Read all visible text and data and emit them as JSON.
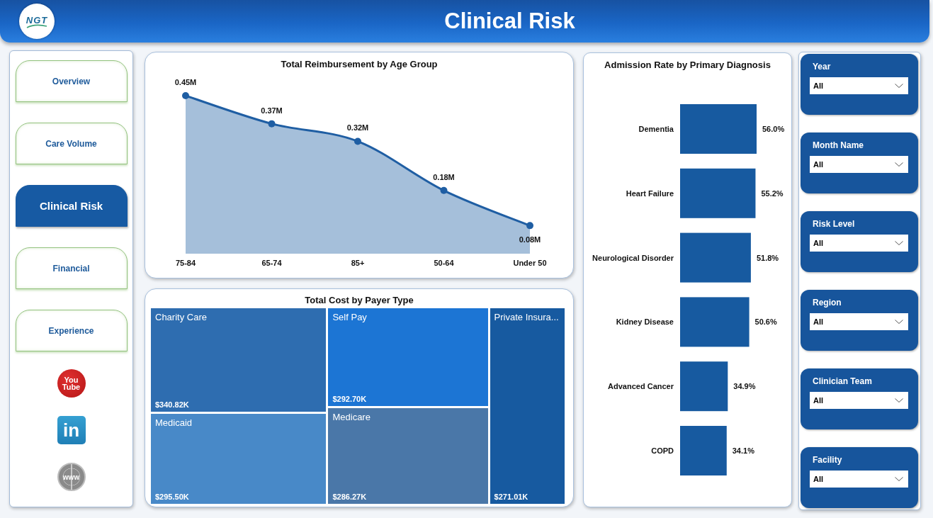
{
  "header": {
    "logo_text": "NGT",
    "title": "Clinical Risk"
  },
  "nav": {
    "items": [
      {
        "label": "Overview",
        "selected": false
      },
      {
        "label": "Care Volume",
        "selected": false
      },
      {
        "label": "Clinical Risk",
        "selected": true
      },
      {
        "label": "Financial",
        "selected": false
      },
      {
        "label": "Experience",
        "selected": false
      }
    ],
    "links": [
      {
        "kind": "youtube",
        "text": "You Tube"
      },
      {
        "kind": "linkedin",
        "text": "in"
      },
      {
        "kind": "website",
        "text": "www"
      }
    ]
  },
  "reimbursement": {
    "title": "Total Reimbursement by Age Group",
    "points": [
      {
        "age_group": "75-84",
        "amount": "0.45M"
      },
      {
        "age_group": "65-74",
        "amount": "0.37M"
      },
      {
        "age_group": "85+",
        "amount": "0.32M"
      },
      {
        "age_group": "50-64",
        "amount": "0.18M"
      },
      {
        "age_group": "Under 50",
        "amount": "0.08M"
      }
    ]
  },
  "payer_cost": {
    "title": "Total Cost by Payer Type",
    "tiles": [
      {
        "payer": "Charity Care",
        "cost": "$340.82K",
        "color": "#2e6db0"
      },
      {
        "payer": "Medicaid",
        "cost": "$295.50K",
        "color": "#4889c8"
      },
      {
        "payer": "Self Pay",
        "cost": "$292.70K",
        "color": "#1c75d4"
      },
      {
        "payer": "Medicare",
        "cost": "$286.27K",
        "color": "#4a77a8"
      },
      {
        "payer": "Private Insura...",
        "cost": "$271.01K",
        "color": "#175aa0"
      }
    ]
  },
  "admission_rate": {
    "title": "Admission Rate by Primary Diagnosis",
    "bars": [
      {
        "diagnosis": "Dementia",
        "rate": "56.0%"
      },
      {
        "diagnosis": "Heart Failure",
        "rate": "55.2%"
      },
      {
        "diagnosis": "Neurological Disorder",
        "rate": "51.8%"
      },
      {
        "diagnosis": "Kidney Disease",
        "rate": "50.6%"
      },
      {
        "diagnosis": "Advanced Cancer",
        "rate": "34.9%"
      },
      {
        "diagnosis": "COPD",
        "rate": "34.1%"
      }
    ]
  },
  "filters": [
    {
      "label": "Year",
      "value": "All"
    },
    {
      "label": "Month Name",
      "value": "All"
    },
    {
      "label": "Risk Level",
      "value": "All"
    },
    {
      "label": "Region",
      "value": "All"
    },
    {
      "label": "Clinician Team",
      "value": "All"
    },
    {
      "label": "Facility",
      "value": "All"
    }
  ]
}
